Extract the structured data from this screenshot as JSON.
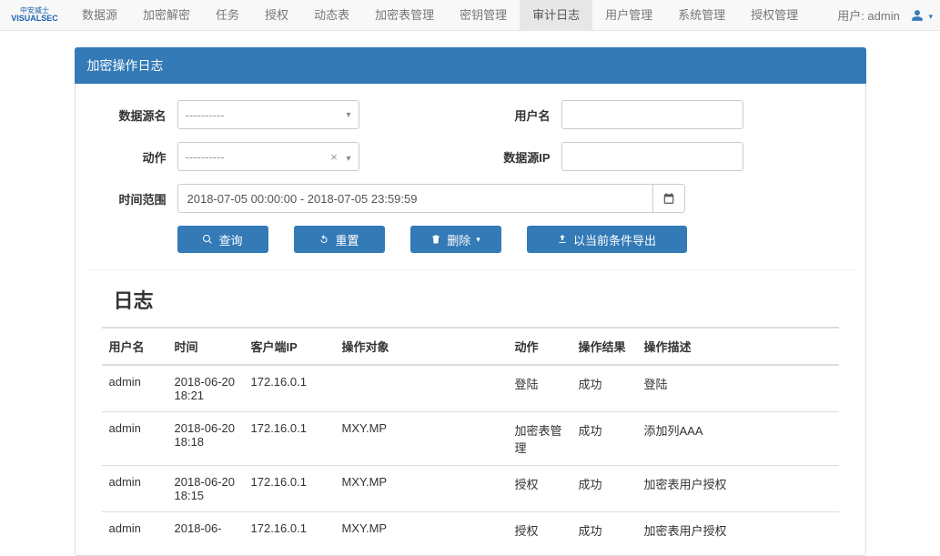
{
  "nav": {
    "items": [
      "数据源",
      "加密解密",
      "任务",
      "授权",
      "动态表",
      "加密表管理",
      "密钥管理",
      "审计日志",
      "用户管理",
      "系统管理",
      "授权管理"
    ],
    "active_index": 7
  },
  "user": {
    "label": "用户: admin"
  },
  "panel": {
    "title": "加密操作日志"
  },
  "search": {
    "labels": {
      "datasource": "数据源名",
      "username": "用户名",
      "action": "动作",
      "ip": "数据源IP",
      "timerange": "时间范围"
    },
    "datasource_placeholder": "----------",
    "action_placeholder": "----------",
    "username_value": "",
    "ip_value": "",
    "daterange_value": "2018-07-05 00:00:00 - 2018-07-05 23:59:59"
  },
  "buttons": {
    "query": "查询",
    "reset": "重置",
    "delete": "删除",
    "export": "以当前条件导出"
  },
  "log": {
    "title": "日志",
    "columns": [
      "用户名",
      "时间",
      "客户端IP",
      "操作对象",
      "动作",
      "操作结果",
      "操作描述"
    ],
    "rows": [
      {
        "user": "admin",
        "time": "2018-06-20 18:21",
        "ip": "172.16.0.1",
        "obj": "",
        "act": "登陆",
        "res": "成功",
        "desc": "登陆"
      },
      {
        "user": "admin",
        "time": "2018-06-20 18:18",
        "ip": "172.16.0.1",
        "obj": "MXY.MP",
        "act": "加密表管理",
        "res": "成功",
        "desc": "添加列AAA"
      },
      {
        "user": "admin",
        "time": "2018-06-20 18:15",
        "ip": "172.16.0.1",
        "obj": "MXY.MP",
        "act": "授权",
        "res": "成功",
        "desc": "加密表用户授权"
      },
      {
        "user": "admin",
        "time": "2018-06-",
        "ip": "172.16.0.1",
        "obj": "MXY.MP",
        "act": "授权",
        "res": "成功",
        "desc": "加密表用户授权"
      }
    ]
  }
}
